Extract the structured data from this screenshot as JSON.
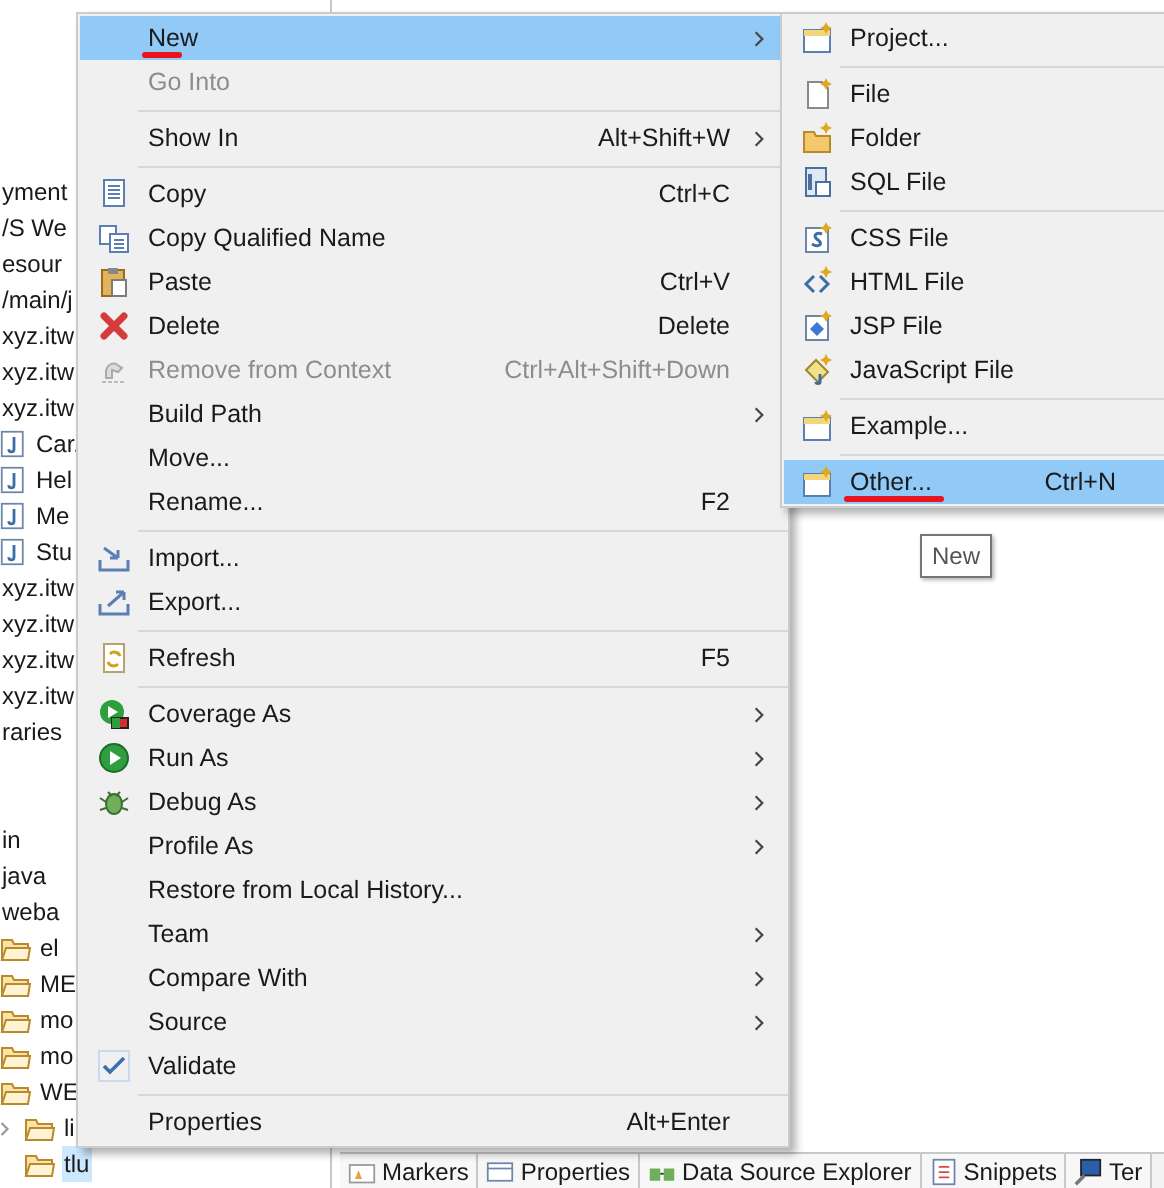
{
  "tree": {
    "groups": [
      [
        {
          "label": "yment",
          "kind": "plain"
        },
        {
          "label": "/S We",
          "kind": "plain"
        },
        {
          "label": "esour",
          "kind": "plain"
        },
        {
          "label": "/main/j",
          "kind": "plain"
        },
        {
          "label": "xyz.itw",
          "kind": "plain"
        },
        {
          "label": "xyz.itw",
          "kind": "plain"
        },
        {
          "label": "xyz.itw",
          "kind": "plain"
        },
        {
          "label": "Car.",
          "kind": "java"
        },
        {
          "label": "Hel",
          "kind": "java"
        },
        {
          "label": "Me",
          "kind": "java"
        },
        {
          "label": "Stu",
          "kind": "java"
        },
        {
          "label": "xyz.itw",
          "kind": "plain"
        },
        {
          "label": "xyz.itw",
          "kind": "plain"
        },
        {
          "label": "xyz.itw",
          "kind": "plain"
        },
        {
          "label": "xyz.itw",
          "kind": "plain"
        },
        {
          "label": "raries",
          "kind": "plain"
        }
      ],
      [
        {
          "label": "in",
          "kind": "plain"
        },
        {
          "label": "java",
          "kind": "plain"
        },
        {
          "label": "weba",
          "kind": "plain"
        },
        {
          "label": "el",
          "kind": "folder"
        },
        {
          "label": "ME",
          "kind": "folder"
        },
        {
          "label": "mo",
          "kind": "folder"
        },
        {
          "label": "mo",
          "kind": "folder"
        },
        {
          "label": "WE",
          "kind": "folder",
          "children": [
            {
              "label": "li",
              "kind": "folder",
              "expanded": false,
              "selected": false
            },
            {
              "label": "tlu",
              "kind": "folder",
              "selected": true
            }
          ]
        }
      ]
    ]
  },
  "context_menu": {
    "items": [
      {
        "kind": "plain",
        "label": "New",
        "submenu": true,
        "selected": true,
        "disabled": false,
        "underlined": true
      },
      {
        "kind": "plain",
        "label": "Go Into",
        "submenu": false,
        "selected": false,
        "disabled": true,
        "underlined": false
      },
      {
        "kind": "separator"
      },
      {
        "kind": "plain",
        "label": "Show In",
        "shortcut": "Alt+Shift+W",
        "submenu": true,
        "selected": false,
        "disabled": false,
        "underlined": false
      },
      {
        "kind": "separator"
      },
      {
        "kind": "copy",
        "label": "Copy",
        "shortcut": "Ctrl+C",
        "submenu": false,
        "selected": false,
        "disabled": false,
        "underlined": false
      },
      {
        "kind": "copy2",
        "label": "Copy Qualified Name",
        "submenu": false,
        "selected": false,
        "disabled": false,
        "underlined": false
      },
      {
        "kind": "paste",
        "label": "Paste",
        "shortcut": "Ctrl+V",
        "submenu": false,
        "selected": false,
        "disabled": false,
        "underlined": false
      },
      {
        "kind": "delete",
        "label": "Delete",
        "shortcut": "Delete",
        "submenu": false,
        "selected": false,
        "disabled": false,
        "underlined": false
      },
      {
        "kind": "remove",
        "label": "Remove from Context",
        "shortcut": "Ctrl+Alt+Shift+Down",
        "submenu": false,
        "selected": false,
        "disabled": true,
        "underlined": false
      },
      {
        "kind": "plain",
        "label": "Build Path",
        "submenu": true,
        "selected": false,
        "disabled": false,
        "underlined": false
      },
      {
        "kind": "plain",
        "label": "Move...",
        "submenu": false,
        "selected": false,
        "disabled": false,
        "underlined": false
      },
      {
        "kind": "plain",
        "label": "Rename...",
        "shortcut": "F2",
        "submenu": false,
        "selected": false,
        "disabled": false,
        "underlined": false
      },
      {
        "kind": "separator"
      },
      {
        "kind": "import",
        "label": "Import...",
        "submenu": false,
        "selected": false,
        "disabled": false,
        "underlined": false
      },
      {
        "kind": "export",
        "label": "Export...",
        "submenu": false,
        "selected": false,
        "disabled": false,
        "underlined": false
      },
      {
        "kind": "separator"
      },
      {
        "kind": "refresh",
        "label": "Refresh",
        "shortcut": "F5",
        "submenu": false,
        "selected": false,
        "disabled": false,
        "underlined": false
      },
      {
        "kind": "separator"
      },
      {
        "kind": "coverage",
        "label": "Coverage As",
        "submenu": true,
        "selected": false,
        "disabled": false,
        "underlined": false
      },
      {
        "kind": "run",
        "label": "Run As",
        "submenu": true,
        "selected": false,
        "disabled": false,
        "underlined": false
      },
      {
        "kind": "debug",
        "label": "Debug As",
        "submenu": true,
        "selected": false,
        "disabled": false,
        "underlined": false
      },
      {
        "kind": "plain",
        "label": "Profile As",
        "submenu": true,
        "selected": false,
        "disabled": false,
        "underlined": false
      },
      {
        "kind": "plain",
        "label": "Restore from Local History...",
        "submenu": false,
        "selected": false,
        "disabled": false,
        "underlined": false
      },
      {
        "kind": "plain",
        "label": "Team",
        "submenu": true,
        "selected": false,
        "disabled": false,
        "underlined": false
      },
      {
        "kind": "plain",
        "label": "Compare With",
        "submenu": true,
        "selected": false,
        "disabled": false,
        "underlined": false
      },
      {
        "kind": "plain",
        "label": "Source",
        "submenu": true,
        "selected": false,
        "disabled": false,
        "underlined": false
      },
      {
        "kind": "check",
        "label": "Validate",
        "submenu": false,
        "selected": false,
        "disabled": false,
        "underlined": false
      },
      {
        "kind": "separator"
      },
      {
        "kind": "plain",
        "label": "Properties",
        "shortcut": "Alt+Enter",
        "submenu": false,
        "selected": false,
        "disabled": false,
        "underlined": false
      }
    ]
  },
  "submenu": {
    "items": [
      {
        "kind": "project",
        "label": "Project...",
        "selected": false,
        "underlined": false
      },
      {
        "kind": "separator"
      },
      {
        "kind": "file",
        "label": "File",
        "selected": false,
        "underlined": false
      },
      {
        "kind": "folder",
        "label": "Folder",
        "selected": false,
        "underlined": false
      },
      {
        "kind": "sql",
        "label": "SQL File",
        "selected": false,
        "underlined": false
      },
      {
        "kind": "separator"
      },
      {
        "kind": "css",
        "label": "CSS File",
        "selected": false,
        "underlined": false
      },
      {
        "kind": "html",
        "label": "HTML File",
        "selected": false,
        "underlined": false
      },
      {
        "kind": "jsp",
        "label": "JSP File",
        "selected": false,
        "underlined": false
      },
      {
        "kind": "js",
        "label": "JavaScript File",
        "selected": false,
        "underlined": false
      },
      {
        "kind": "separator"
      },
      {
        "kind": "project",
        "label": "Example...",
        "selected": false,
        "underlined": false
      },
      {
        "kind": "separator"
      },
      {
        "kind": "project",
        "label": "Other...",
        "shortcut": "Ctrl+N",
        "selected": true,
        "underlined": true
      }
    ]
  },
  "tooltip": {
    "text": "New"
  },
  "bottom_tabs": [
    {
      "label": "Markers",
      "kind": "markers"
    },
    {
      "label": "Properties",
      "kind": "properties"
    },
    {
      "label": "Data Source Explorer",
      "kind": "datasource"
    },
    {
      "label": "Snippets",
      "kind": "snippets"
    },
    {
      "label": "Ter",
      "kind": "terminal"
    }
  ]
}
